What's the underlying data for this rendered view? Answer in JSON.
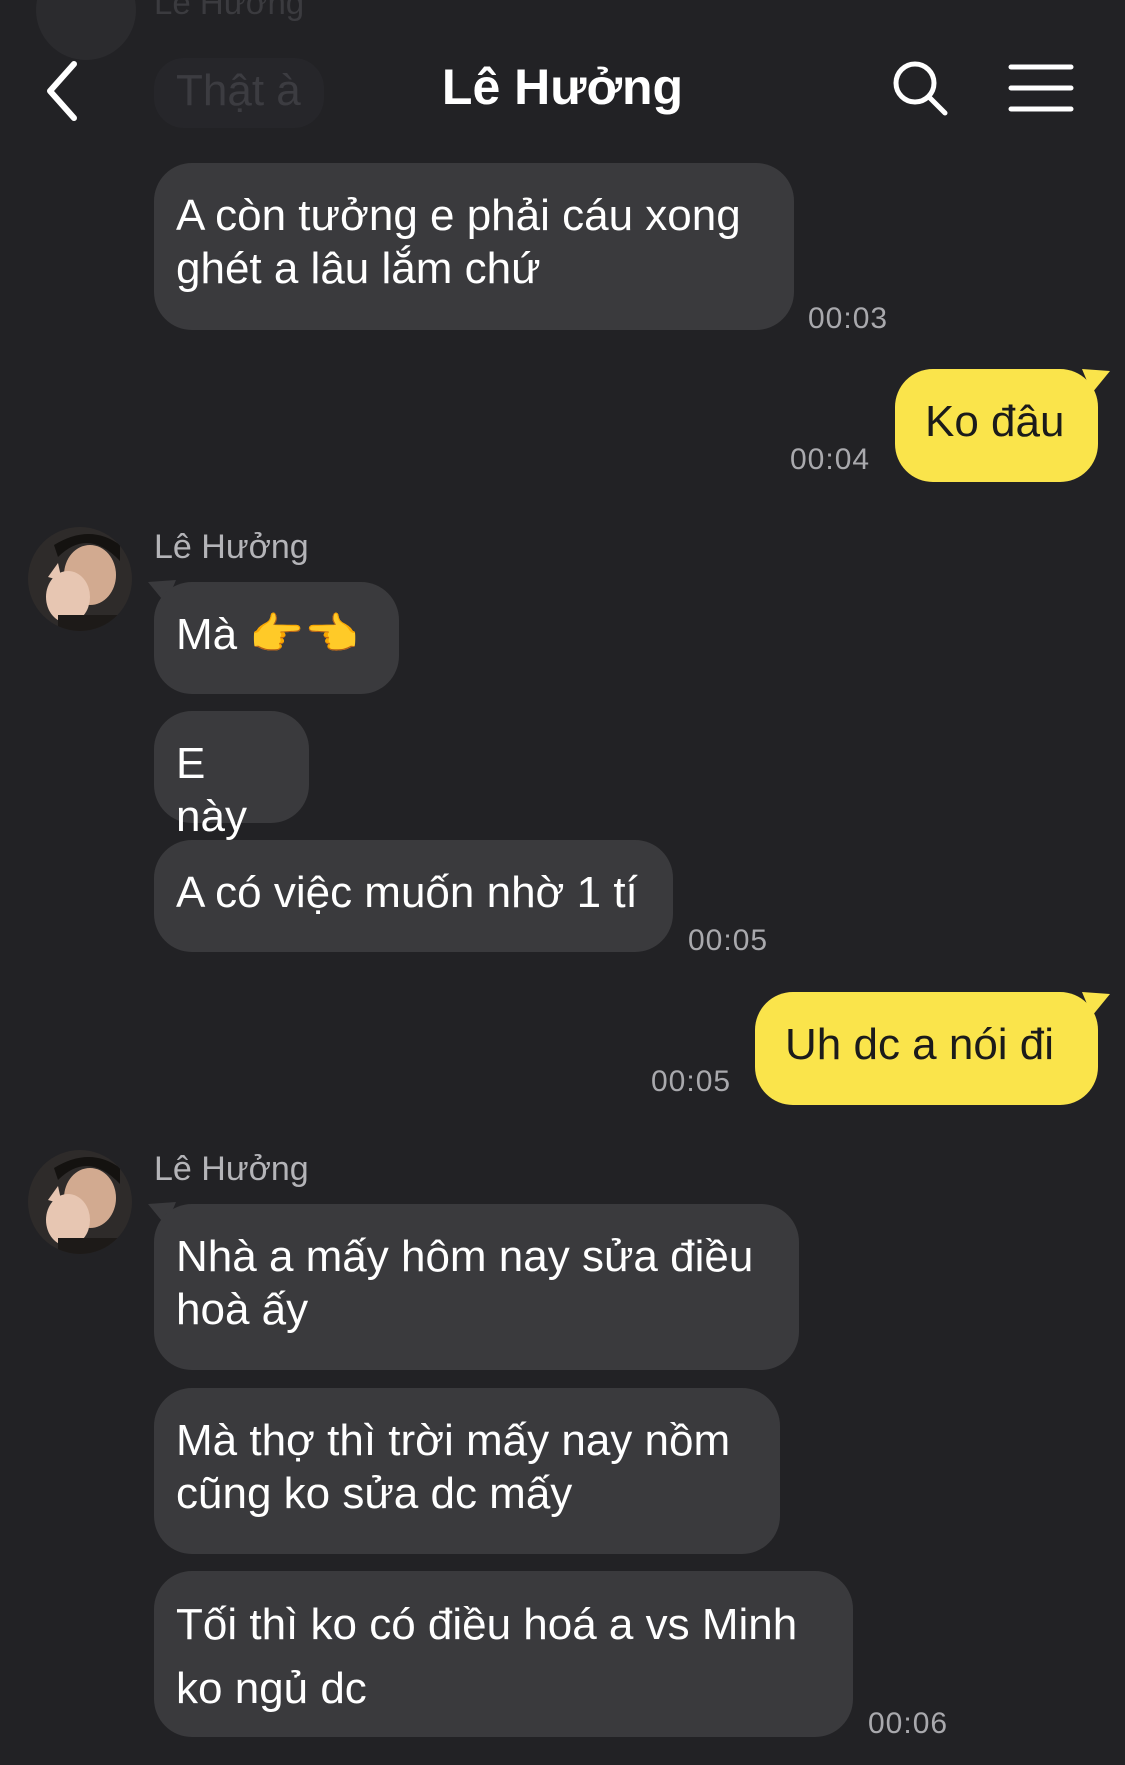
{
  "header": {
    "title": "Lê Hưởng",
    "back_icon": "chevron-left-icon",
    "search_icon": "search-icon",
    "menu_icon": "hamburger-menu-icon"
  },
  "ghost": {
    "sender": "Lê Hưởng",
    "text": "Thật à"
  },
  "colors": {
    "background": "#222225",
    "received_bubble": "#3a3a3d",
    "sent_bubble": "#fae44b"
  },
  "messages": [
    {
      "direction": "received",
      "text": "A còn tưởng e phải cáu xong ghét a lâu lắm chứ",
      "time": "00:03"
    },
    {
      "direction": "sent",
      "text": "Ko đâu",
      "time": "00:04"
    },
    {
      "direction": "received",
      "sender": "Lê Hưởng",
      "text": "Mà 👉👈"
    },
    {
      "direction": "received",
      "text": "E này"
    },
    {
      "direction": "received",
      "text": "A có việc muốn nhờ 1 tí",
      "time": "00:05"
    },
    {
      "direction": "sent",
      "text": "Uh dc a nói đi",
      "time": "00:05"
    },
    {
      "direction": "received",
      "sender": "Lê Hưởng",
      "text": "Nhà a mấy hôm nay sửa điều hoà ấy"
    },
    {
      "direction": "received",
      "text": "Mà thợ thì trời mấy nay nồm cũng ko sửa dc mấy"
    },
    {
      "direction": "received",
      "text": "Tối thì ko có điều hoá a vs Minh ko ngủ dc",
      "time": "00:06"
    }
  ]
}
